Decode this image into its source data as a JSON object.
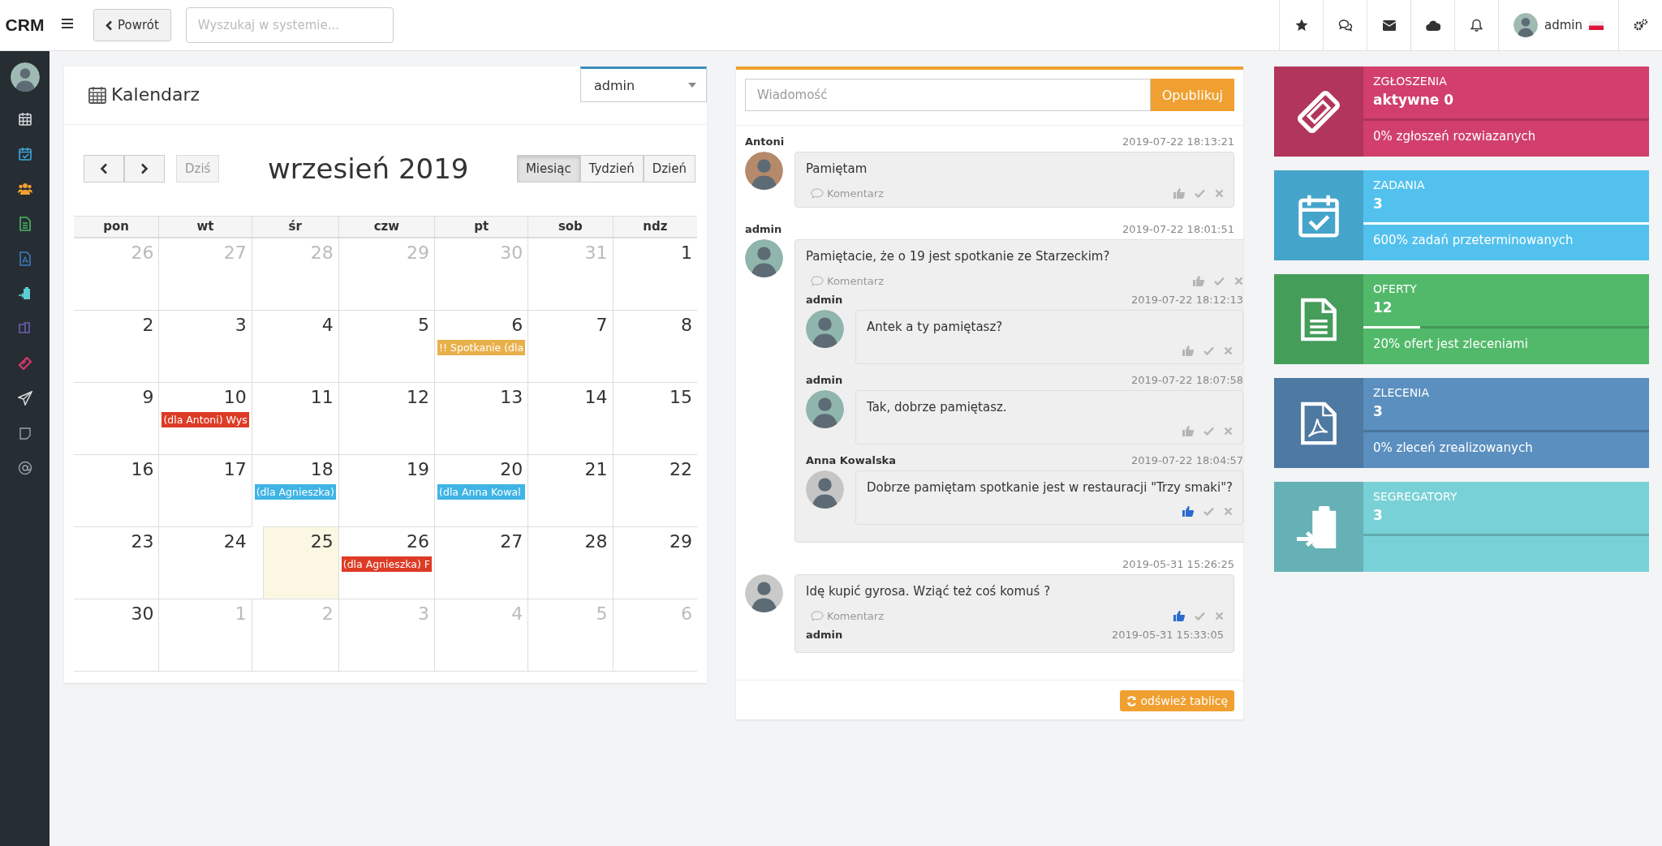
{
  "brand": "CRM",
  "topbar": {
    "back_button": "Powrót",
    "search": {
      "placeholder": "Wyszukaj w systemie..."
    },
    "user": "admin"
  },
  "calendar": {
    "title": "Kalendarz",
    "user_select": "admin",
    "today_button": "Dziś",
    "month_title": "wrzesień 2019",
    "views": [
      {
        "label": "Miesiąc",
        "selected": true
      },
      {
        "label": "Tydzień",
        "selected": false
      },
      {
        "label": "Dzień",
        "selected": false
      }
    ],
    "weekdays": [
      "pon",
      "wt",
      "śr",
      "czw",
      "pt",
      "sob",
      "ndz"
    ],
    "weeks": [
      [
        {
          "day": "26",
          "other_month": true,
          "today": false
        },
        {
          "day": "27",
          "other_month": true,
          "today": false
        },
        {
          "day": "28",
          "other_month": true,
          "today": false
        },
        {
          "day": "29",
          "other_month": true,
          "today": false
        },
        {
          "day": "30",
          "other_month": true,
          "today": false
        },
        {
          "day": "31",
          "other_month": true,
          "today": false
        },
        {
          "day": "1",
          "other_month": false,
          "today": false
        }
      ],
      [
        {
          "day": "2",
          "other_month": false,
          "today": false
        },
        {
          "day": "3",
          "other_month": false,
          "today": false
        },
        {
          "day": "4",
          "other_month": false,
          "today": false
        },
        {
          "day": "5",
          "other_month": false,
          "today": false
        },
        {
          "day": "6",
          "other_month": false,
          "today": false,
          "events": [
            {
              "title": "!! Spotkanie (dla",
              "color": "#e8b04a"
            }
          ]
        },
        {
          "day": "7",
          "other_month": false,
          "today": false
        },
        {
          "day": "8",
          "other_month": false,
          "today": false
        }
      ],
      [
        {
          "day": "9",
          "other_month": false,
          "today": false
        },
        {
          "day": "10",
          "other_month": false,
          "today": false,
          "events": [
            {
              "title": "(dla Antoni) Wys",
              "color": "#dd3b26"
            }
          ]
        },
        {
          "day": "11",
          "other_month": false,
          "today": false
        },
        {
          "day": "12",
          "other_month": false,
          "today": false
        },
        {
          "day": "13",
          "other_month": false,
          "today": false
        },
        {
          "day": "14",
          "other_month": false,
          "today": false
        },
        {
          "day": "15",
          "other_month": false,
          "today": false
        }
      ],
      [
        {
          "day": "16",
          "other_month": false,
          "today": false
        },
        {
          "day": "17",
          "other_month": false,
          "today": false
        },
        {
          "day": "18",
          "other_month": false,
          "today": false,
          "events": [
            {
              "title": "(dla Agnieszka)",
              "color": "#3fb4e5"
            }
          ]
        },
        {
          "day": "19",
          "other_month": false,
          "today": false
        },
        {
          "day": "20",
          "other_month": false,
          "today": false,
          "events": [
            {
              "title": "(dla Anna Kowal",
              "color": "#3fb4e5"
            }
          ]
        },
        {
          "day": "21",
          "other_month": false,
          "today": false
        },
        {
          "day": "22",
          "other_month": false,
          "today": false
        }
      ],
      [
        {
          "day": "23",
          "other_month": false,
          "today": false
        },
        {
          "day": "24",
          "other_month": false,
          "today": false
        },
        {
          "day": "25",
          "other_month": false,
          "today": true
        },
        {
          "day": "26",
          "other_month": false,
          "today": false,
          "events": [
            {
              "title": "(dla Agnieszka) F",
              "color": "#dd3b26"
            }
          ]
        },
        {
          "day": "27",
          "other_month": false,
          "today": false
        },
        {
          "day": "28",
          "other_month": false,
          "today": false
        },
        {
          "day": "29",
          "other_month": false,
          "today": false
        }
      ],
      [
        {
          "day": "30",
          "other_month": false,
          "today": false
        },
        {
          "day": "1",
          "other_month": true,
          "today": false
        },
        {
          "day": "2",
          "other_month": true,
          "today": false
        },
        {
          "day": "3",
          "other_month": true,
          "today": false
        },
        {
          "day": "4",
          "other_month": true,
          "today": false
        },
        {
          "day": "5",
          "other_month": true,
          "today": false
        },
        {
          "day": "6",
          "other_month": true,
          "today": false
        }
      ]
    ]
  },
  "feed": {
    "message_placeholder": "Wiadomość",
    "publish_button": "Opublikuj",
    "refresh_button": "odśwież tablicę",
    "posts": [
      {
        "author": "Antoni",
        "time": "2019-07-22 18:13:21",
        "text": "Pamiętam",
        "comment_link": "Komentarz",
        "liked": false
      },
      {
        "author": "admin",
        "time": "2019-07-22 18:01:51",
        "text": "Pamiętacie, że o 19 jest spotkanie ze Starzeckim?",
        "comment_link": "Komentarz",
        "liked": false,
        "replies": [
          {
            "author": "admin",
            "time": "2019-07-22 18:12:13",
            "text": "Antek a ty pamiętasz?",
            "liked": false
          },
          {
            "author": "admin",
            "time": "2019-07-22 18:07:58",
            "text": "Tak, dobrze pamiętasz.",
            "liked": false
          },
          {
            "author": "Anna Kowalska",
            "time": "2019-07-22 18:04:57",
            "text": "Dobrze pamiętam spotkanie jest w restauracji \"Trzy smaki\"?",
            "liked": true
          }
        ]
      },
      {
        "time": "2019-05-31 15:26:25",
        "text": "Idę kupić gyrosa. Wziąć też coś komuś ?",
        "comment_link": "Komentarz",
        "liked": true,
        "replies": [
          {
            "author": "admin",
            "time": "2019-05-31 15:33:05"
          }
        ]
      }
    ]
  },
  "tiles": [
    {
      "kind": "ticket",
      "title": "ZGŁOSZENIA",
      "value": "aktywne 0",
      "footer": "0% zgłoszeń rozwiazanych",
      "level": 0,
      "color": "#d23f6c"
    },
    {
      "kind": "calendar",
      "title": "ZADANIA",
      "value": "3",
      "footer": "600% zadań przeterminowanych",
      "level": 1,
      "color": "#52c1ee"
    },
    {
      "kind": "document",
      "title": "OFERTY",
      "value": "12",
      "footer": "20% ofert jest zleceniami",
      "level": 0.2,
      "color": "#52b96a"
    },
    {
      "kind": "pdf",
      "title": "ZLECENIA",
      "value": "3",
      "footer": "0% zleceń zrealizowanych",
      "level": 0,
      "color": "#5b8fbf"
    },
    {
      "kind": "clipboard",
      "title": "SEGREGATORY",
      "value": "3",
      "level": 0,
      "color": "#78d1d6"
    }
  ]
}
